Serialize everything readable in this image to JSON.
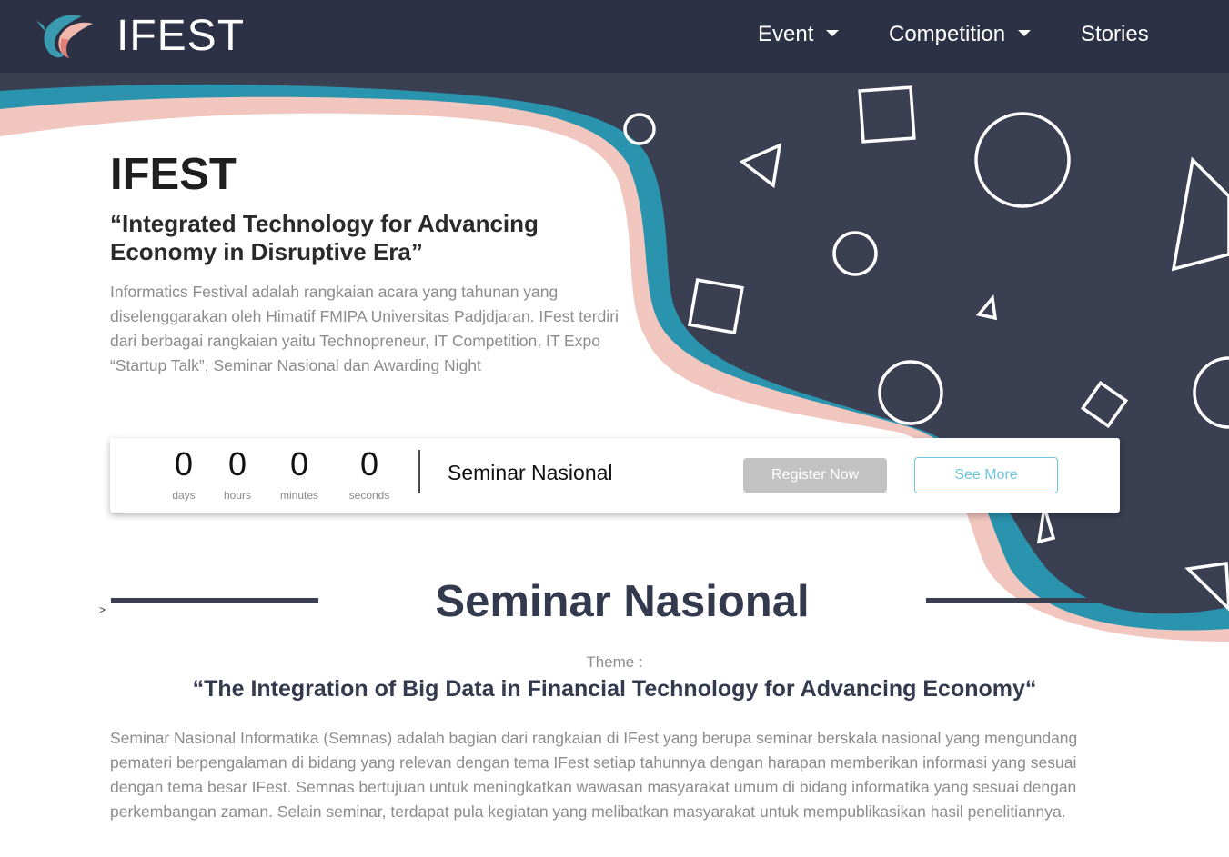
{
  "nav": {
    "brand": "IFEST",
    "items": [
      {
        "label": "Event",
        "dropdown": true
      },
      {
        "label": "Competition",
        "dropdown": true
      },
      {
        "label": "Stories",
        "dropdown": false
      }
    ]
  },
  "hero": {
    "title": "IFEST",
    "tagline": "“Integrated Technology for Advancing Economy in Disruptive Era”",
    "description": "Informatics Festival adalah rangkaian acara yang tahunan yang diselenggarakan oleh Himatif FMIPA Universitas Padjdjaran. IFest terdiri dari berbagai rangkaian yaitu Technopreneur, IT Competition, IT Expo “Startup Talk”, Seminar Nasional dan Awarding Night"
  },
  "countdown": {
    "days": "0",
    "days_label": "days",
    "hours": "0",
    "hours_label": "hours",
    "minutes": "0",
    "minutes_label": "minutes",
    "seconds": "0",
    "seconds_label": "seconds",
    "event_name": "Seminar Nasional",
    "register_label": "Register Now",
    "more_label": "See More"
  },
  "seminar": {
    "title": "Seminar Nasional",
    "marker": ">",
    "theme_label": "Theme :",
    "theme": "“The Integration of Big Data in Financial Technology for Advancing Economy“",
    "description": "Seminar Nasional Informatika (Semnas) adalah bagian dari rangkaian di IFest yang berupa seminar berskala nasional yang mengundang pemateri berpengalaman di bidang yang relevan dengan tema IFest setiap tahunnya dengan harapan memberikan informasi yang sesuai dengan tema besar IFest. Semnas bertujuan untuk meningkatkan wawasan masyarakat umum di bidang informatika yang sesuai dengan perkembangan zaman. Selain seminar, terdapat pula kegiatan yang melibatkan masyarakat untuk mempublikasikan hasil penelitiannya."
  },
  "colors": {
    "navbar": "#2c3145",
    "hero_dark": "#3a3f51",
    "wave_teal": "#2a93ad",
    "wave_pink": "#f1c6bf",
    "heading": "#343a4e",
    "muted_text": "#8c8c8c",
    "button_register": "#c2c2c2",
    "button_more": "#6ec5de"
  },
  "icons": {
    "logo": "ifest-feather-logo-icon",
    "dropdown": "caret-down-icon"
  }
}
